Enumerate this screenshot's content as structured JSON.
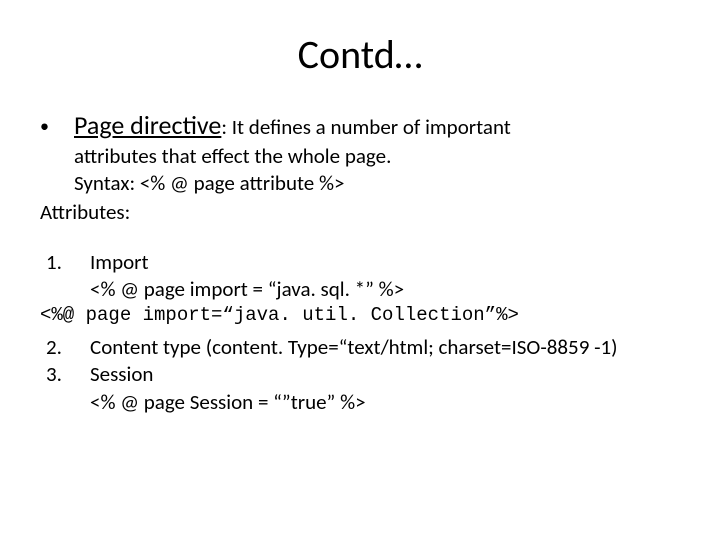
{
  "title": "Contd…",
  "bullet": {
    "lead": "Page directive",
    "rest": ": It defines a number of important",
    "cont": "attributes that effect the whole page.",
    "syntax": "Syntax: <% @ page attribute %>"
  },
  "attributes_label": "Attributes:",
  "items": {
    "n1": "1.",
    "n2": "2.",
    "n3": "3.",
    "import_label": "Import",
    "import_ex": "<% @ page import = “java. sql. *” %>",
    "import_mono": "<%@ page import=“java. util. Collection”%>",
    "content_type": "Content type (content. Type=“text/html; charset=ISO-8859 -1)",
    "session_label": "Session",
    "session_ex": "<% @ page Session = “”true” %>"
  }
}
